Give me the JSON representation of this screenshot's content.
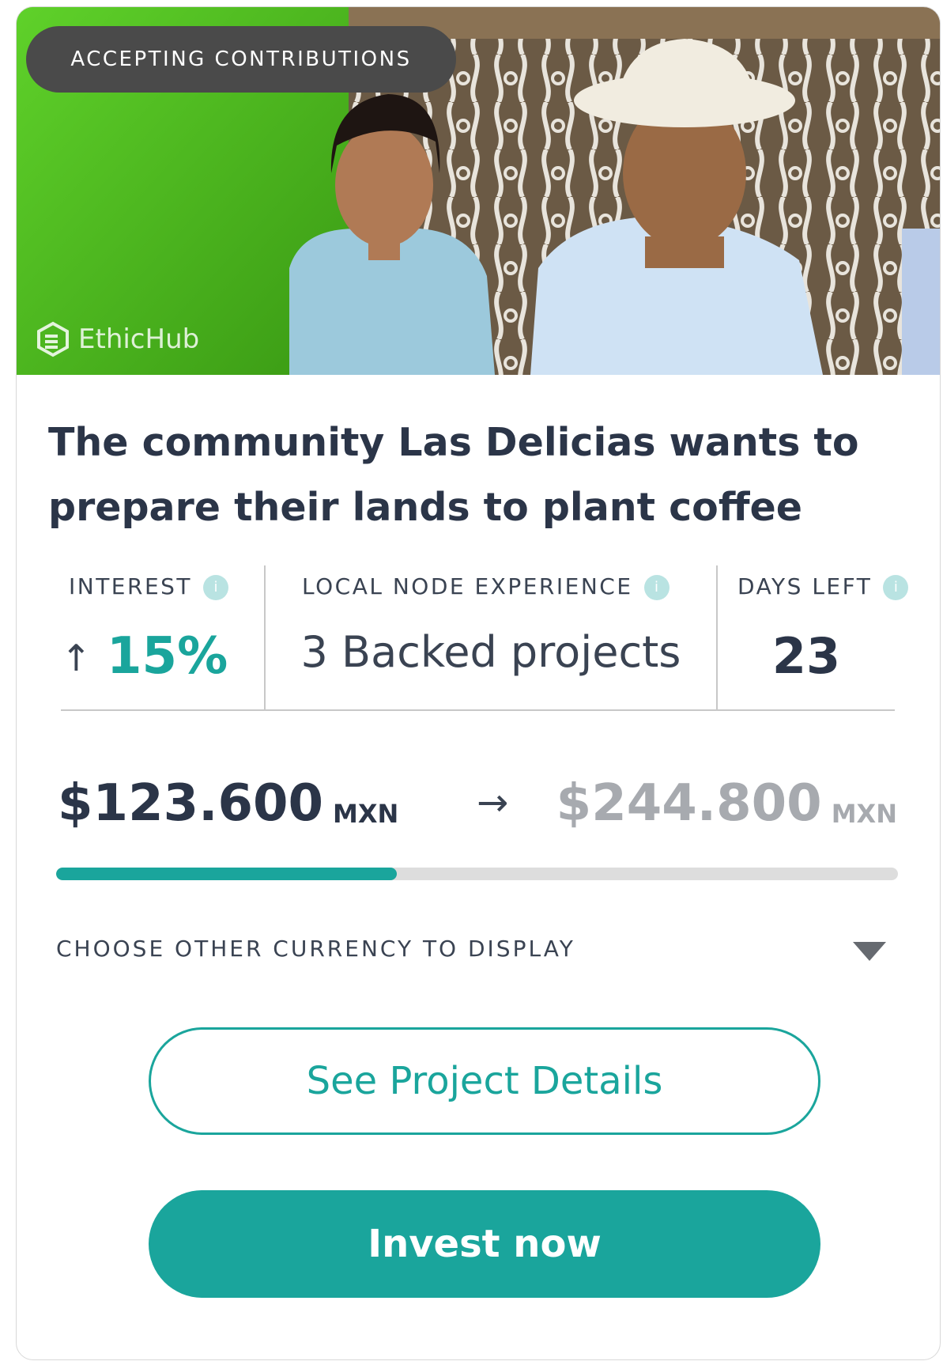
{
  "hero": {
    "status_badge": "ACCEPTING CONTRIBUTIONS",
    "watermark": "EthicHub"
  },
  "project": {
    "title": "The community Las Delicias wants to prepare their lands to plant coffee"
  },
  "stats": {
    "interest": {
      "label": "INTEREST",
      "value": "15%",
      "trend_icon": "up-arrow-icon"
    },
    "node_experience": {
      "label": "LOCAL NODE EXPERIENCE",
      "value": "3 Backed projects"
    },
    "days_left": {
      "label": "DAYS LEFT",
      "value": "23"
    },
    "info_icon_glyph": "i"
  },
  "funding": {
    "raised": "$123.600",
    "raised_currency": "MXN",
    "goal": "$244.800",
    "goal_currency": "MXN",
    "progress_fraction": 0.405
  },
  "currency_selector": {
    "label": "CHOOSE OTHER CURRENCY TO DISPLAY"
  },
  "buttons": {
    "details": "See Project Details",
    "invest": "Invest now"
  },
  "colors": {
    "accent": "#1aa59c",
    "title_text": "#2b3548",
    "badge_bg": "#4a4a4a",
    "muted_text": "#a7aaaf",
    "progress_track": "#dddddd"
  }
}
